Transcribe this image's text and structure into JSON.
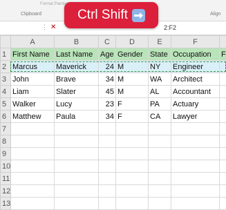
{
  "ribbon": {
    "faint_text": "Format Painter",
    "clipboard_label": "Clipboard",
    "align_label": "Align"
  },
  "formula_bar": {
    "dots": "⋮",
    "cancel_glyph": "✕",
    "ref_text": "2:F2"
  },
  "overlay": {
    "label": "Ctrl Shift",
    "arrow_icon": "right-arrow-icon",
    "bg_color": "#dc1f3b"
  },
  "grid": {
    "columns": [
      "A",
      "B",
      "C",
      "D",
      "E",
      "F",
      ""
    ],
    "rows": [
      "1",
      "2",
      "3",
      "4",
      "5",
      "6",
      "7",
      "8",
      "9",
      "10",
      "11",
      "12",
      "13"
    ],
    "headers": [
      "First Name",
      "Last Name",
      "Age",
      "Gender",
      "State",
      "Occupation",
      "F"
    ],
    "data": [
      [
        "Marcus",
        "Maverick",
        "24",
        "M",
        "NY",
        "Engineer"
      ],
      [
        "John",
        "Brave",
        "34",
        "M",
        "WA",
        "Architect"
      ],
      [
        "Liam",
        "Slater",
        "45",
        "M",
        "AL",
        "Accountant"
      ],
      [
        "Walker",
        "Lucy",
        "23",
        "F",
        "PA",
        "Actuary"
      ],
      [
        "Matthew",
        "Paula",
        "34",
        "F",
        "CA",
        "Lawyer"
      ]
    ],
    "header_fill": "#b9e3b9",
    "selected_row_fill": "#daf0f8"
  }
}
